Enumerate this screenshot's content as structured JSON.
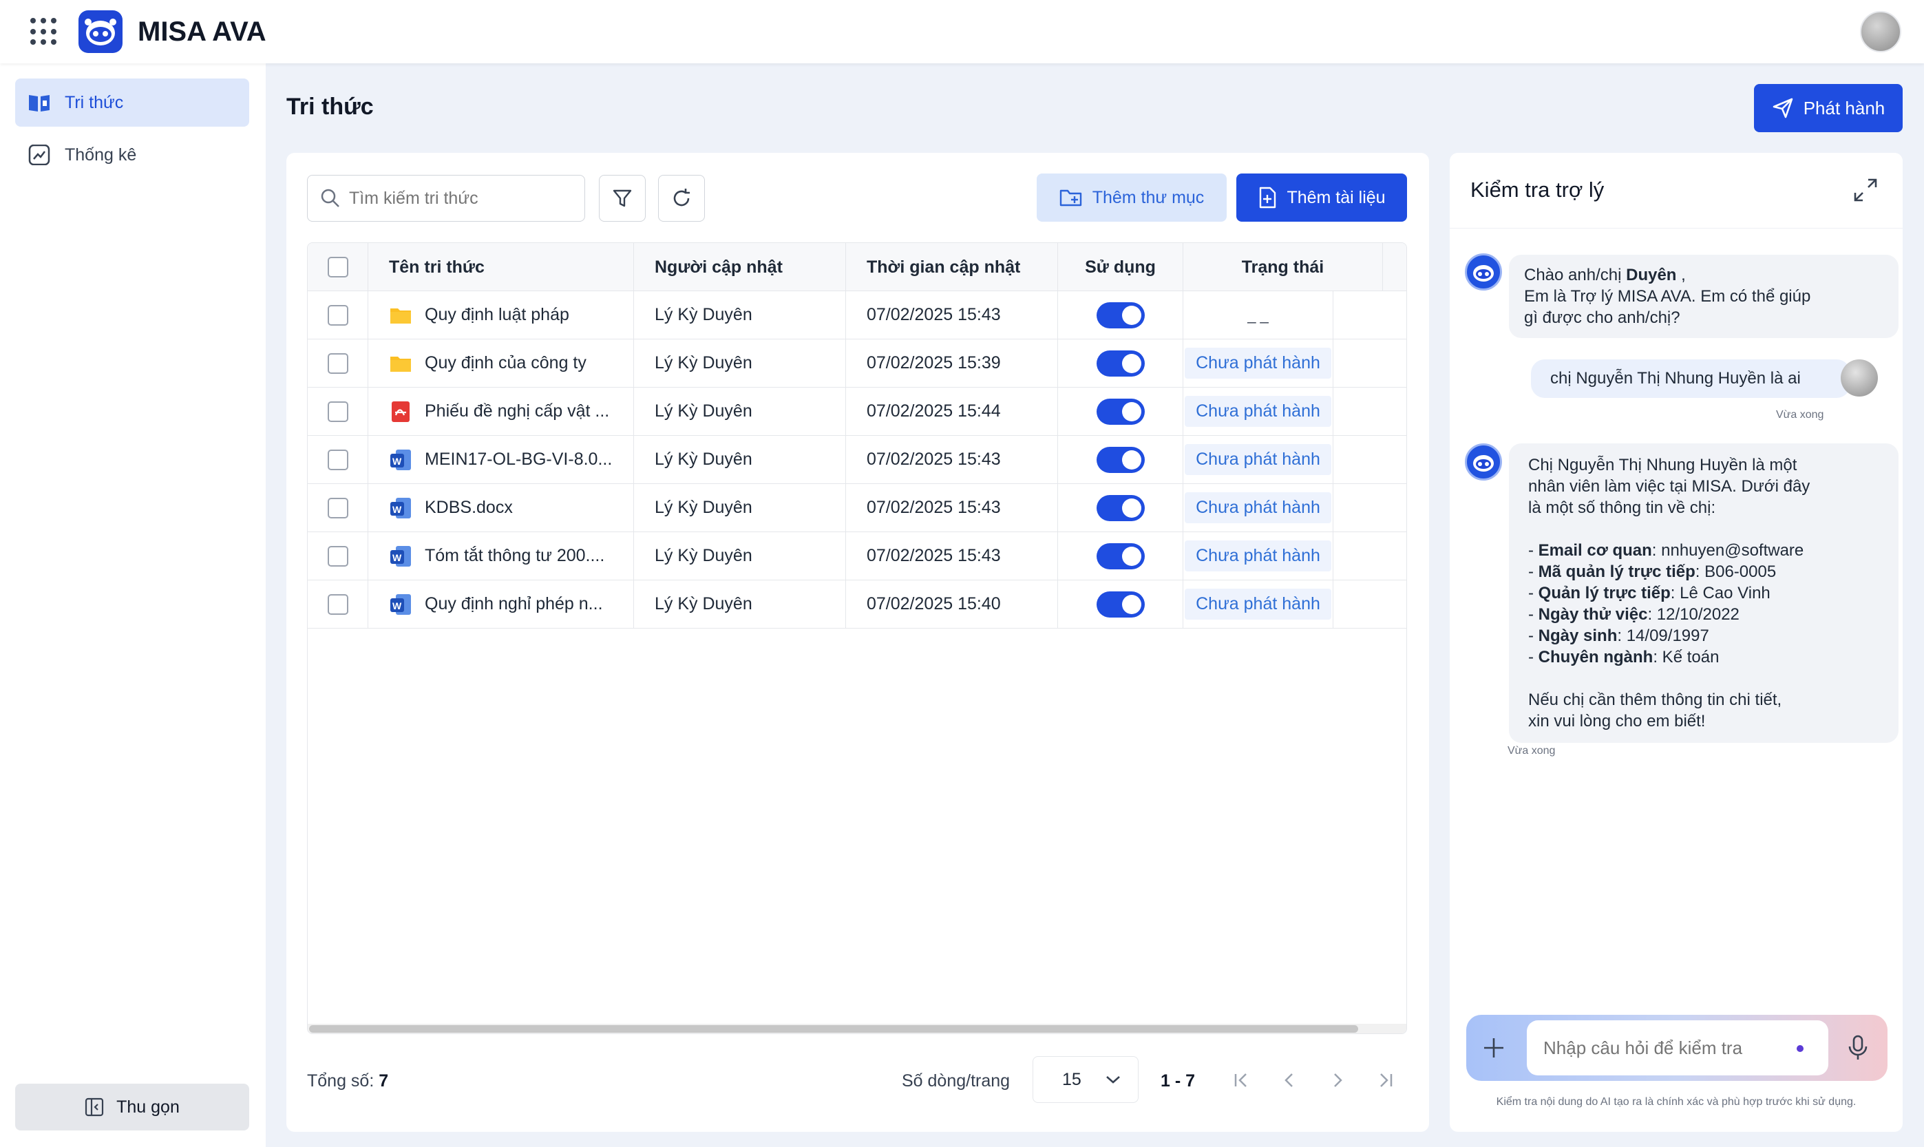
{
  "app": {
    "brand": "MISA AVA"
  },
  "sidebar": {
    "items": [
      {
        "label": "Tri thức",
        "icon": "book-icon",
        "active": true
      },
      {
        "label": "Thống kê",
        "icon": "chart-icon",
        "active": false
      }
    ],
    "collapse_label": "Thu gọn"
  },
  "page": {
    "title": "Tri thức",
    "publish_label": "Phát hành"
  },
  "toolbar": {
    "search_placeholder": "Tìm kiếm tri thức",
    "add_folder_label": "Thêm thư mục",
    "add_doc_label": "Thêm tài liệu"
  },
  "table": {
    "headers": [
      "Tên tri thức",
      "Người cập nhật",
      "Thời gian cập nhật",
      "Sử dụng",
      "Trạng thái"
    ],
    "rows": [
      {
        "type": "folder",
        "name": "Quy định luật pháp",
        "updater": "Lý Kỳ Duyên",
        "time": "07/02/2025 15:43",
        "enabled": true,
        "status": "_ _"
      },
      {
        "type": "folder",
        "name": "Quy định của công ty",
        "updater": "Lý Kỳ Duyên",
        "time": "07/02/2025 15:39",
        "enabled": true,
        "status": "Chưa phát hành"
      },
      {
        "type": "pdf",
        "name": "Phiếu đề nghị cấp vật ...",
        "updater": "Lý Kỳ Duyên",
        "time": "07/02/2025 15:44",
        "enabled": true,
        "status": "Chưa phát hành"
      },
      {
        "type": "word",
        "name": "MEIN17-OL-BG-VI-8.0...",
        "updater": "Lý Kỳ Duyên",
        "time": "07/02/2025 15:43",
        "enabled": true,
        "status": "Chưa phát hành"
      },
      {
        "type": "word",
        "name": "KDBS.docx",
        "updater": "Lý Kỳ Duyên",
        "time": "07/02/2025 15:43",
        "enabled": true,
        "status": "Chưa phát hành"
      },
      {
        "type": "word",
        "name": "Tóm tắt thông tư 200....",
        "updater": "Lý Kỳ Duyên",
        "time": "07/02/2025 15:43",
        "enabled": true,
        "status": "Chưa phát hành"
      },
      {
        "type": "word",
        "name": "Quy định nghỉ phép n...",
        "updater": "Lý Kỳ Duyên",
        "time": "07/02/2025 15:40",
        "enabled": true,
        "status": "Chưa phát hành"
      }
    ]
  },
  "footer": {
    "total_label": "Tổng số:",
    "total_value": "7",
    "rows_per_page_label": "Số dòng/trang",
    "rows_per_page_value": "15",
    "range": "1 - 7"
  },
  "chat": {
    "title": "Kiểm tra trợ lý",
    "greeting_prefix": "Chào anh/chị ",
    "greeting_name": "Duyên",
    "greeting_suffix": " ,",
    "greeting_line2": "Em là Trợ lý MISA AVA. Em có thể giúp",
    "greeting_line3": "gì được cho anh/chị?",
    "user_message": "chị Nguyễn Thị Nhung Huyền là ai",
    "user_time": "Vừa xong",
    "answer_intro_1": "Chị Nguyễn Thị Nhung Huyền là một",
    "answer_intro_2": "nhân viên làm việc tại MISA. Dưới đây",
    "answer_intro_3": "là một số thông tin về chị:",
    "answer_items": [
      {
        "label": "Email cơ quan",
        "value": ": nnhuyen@software"
      },
      {
        "label": "Mã quản lý trực tiếp",
        "value": ": B06-0005"
      },
      {
        "label": "Quản lý trực tiếp",
        "value": ": Lê Cao Vinh"
      },
      {
        "label": "Ngày thử việc",
        "value": ": 12/10/2022"
      },
      {
        "label": "Ngày sinh",
        "value": ": 14/09/1997"
      },
      {
        "label": "Chuyên ngành",
        "value": ": Kế toán"
      }
    ],
    "answer_outro_1": "Nếu chị cần thêm thông tin chi tiết,",
    "answer_outro_2": "xin vui lòng cho em biết!",
    "bot_time": "Vừa xong",
    "input_placeholder": "Nhập câu hỏi để kiểm tra",
    "disclaimer": "Kiểm tra nội dung do AI tạo ra là chính xác và phù hợp trước khi sử dụng."
  },
  "colors": {
    "primary": "#1f4de0",
    "status_text": "#2f6fd6",
    "active_nav_bg": "#dde7fb"
  }
}
